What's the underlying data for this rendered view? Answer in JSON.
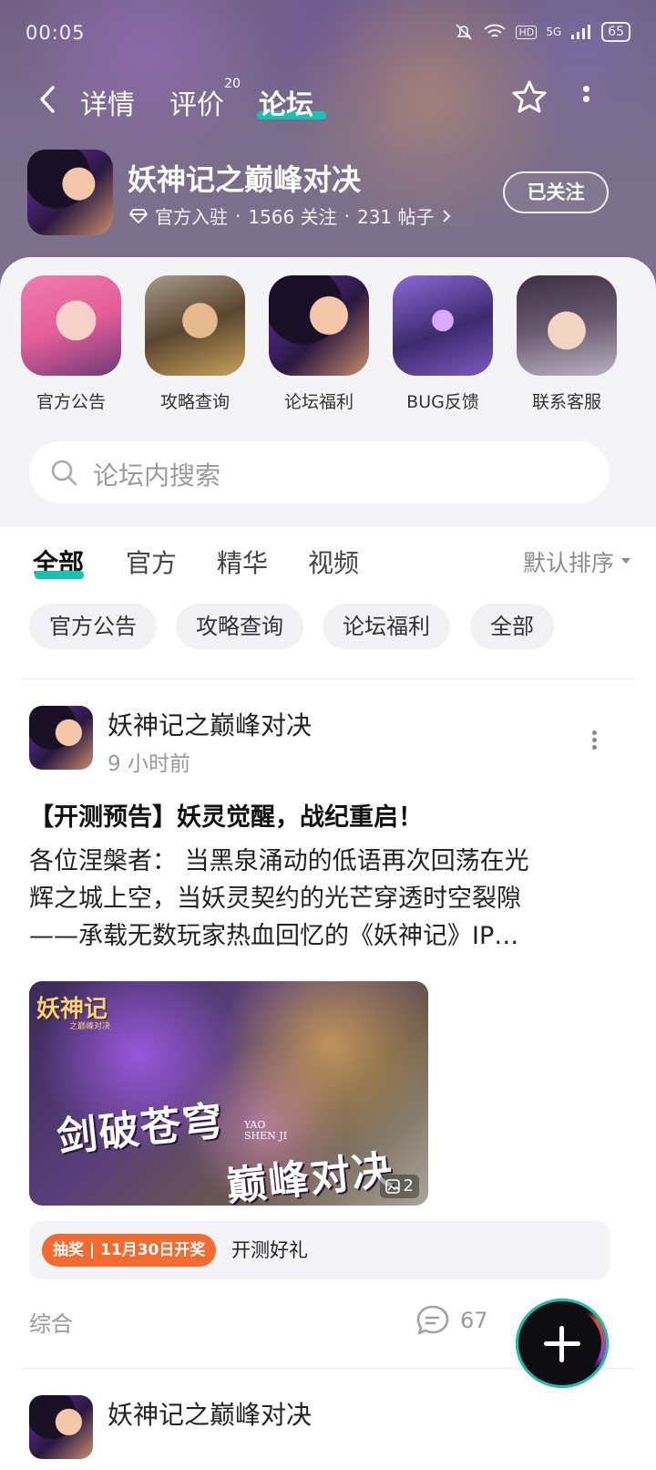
{
  "status_bar": {
    "time": "00:05",
    "network": "5G",
    "hd": "HD",
    "battery": "65"
  },
  "nav": {
    "tabs": [
      {
        "label": "详情"
      },
      {
        "label": "评价",
        "badge": "20"
      },
      {
        "label": "论坛"
      }
    ],
    "active_tab": "论坛",
    "accent_color": "#16c3b0"
  },
  "game": {
    "title": "妖神记之巅峰对决",
    "official": "官方入驻",
    "followers": "1566 关注",
    "posts": "231 帖子",
    "follow_button": "已关注"
  },
  "shortcuts": [
    {
      "label": "官方公告"
    },
    {
      "label": "攻略查询"
    },
    {
      "label": "论坛福利"
    },
    {
      "label": "BUG反馈"
    },
    {
      "label": "联系客服"
    }
  ],
  "search": {
    "placeholder": "论坛内搜索"
  },
  "filter_tabs": [
    {
      "label": "全部"
    },
    {
      "label": "官方"
    },
    {
      "label": "精华"
    },
    {
      "label": "视频"
    }
  ],
  "sort": {
    "label": "默认排序"
  },
  "chips": [
    {
      "label": "官方公告"
    },
    {
      "label": "攻略查询"
    },
    {
      "label": "论坛福利"
    },
    {
      "label": "全部"
    }
  ],
  "post": {
    "author": "妖神记之巅峰对决",
    "time": "9 小时前",
    "title": "【开测预告】妖灵觉醒，战纪重启！",
    "body_lines": [
      "各位涅槃者：  当黑泉涌动的低语再次回荡在光",
      "辉之城上空，当妖灵契约的光芒穿透时空裂隙",
      "——承载无数玩家热血回忆的《妖神记》IP…"
    ],
    "image": {
      "logo": "妖神记",
      "logo_sub": "之巅峰对决",
      "text1": "剑破苍穹",
      "text2": "巅峰对决",
      "en_text": "YAO SHEN JI",
      "count": "2"
    },
    "promo_badge": "抽奖 | 11月30日开奖",
    "promo_text": "开测好礼",
    "category": "综合",
    "comments": "67"
  },
  "next_post": {
    "author": "妖神记之巅峰对决"
  }
}
